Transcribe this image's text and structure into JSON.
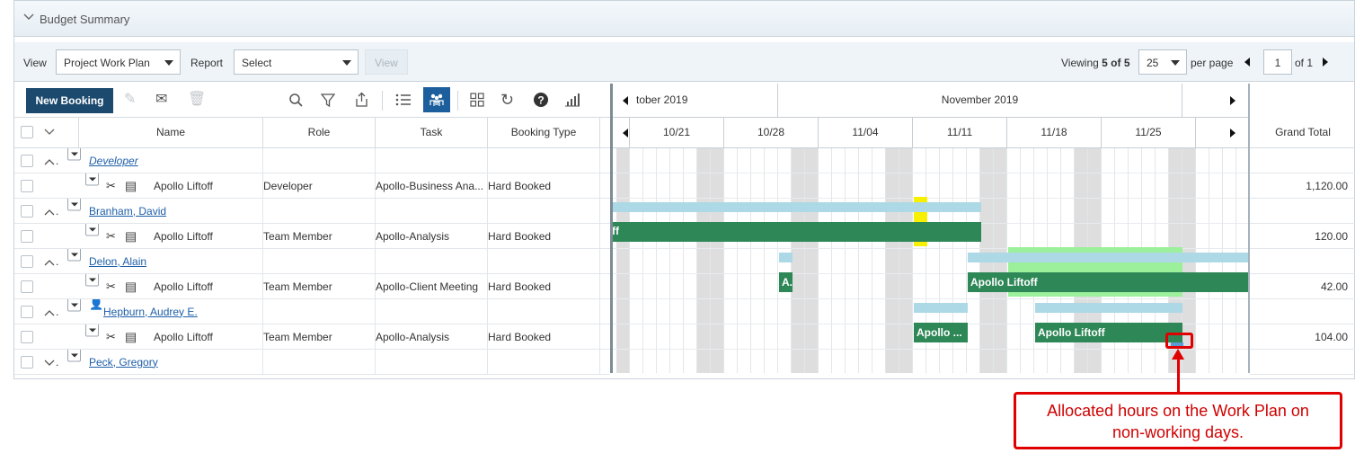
{
  "panel": {
    "title": "Budget Summary"
  },
  "toolbar": {
    "view_label": "View",
    "view_value": "Project Work Plan",
    "report_label": "Report",
    "report_value": "Select",
    "view_button": "View",
    "viewing_prefix": "Viewing",
    "viewing_range": "5 of 5",
    "page_size": "25",
    "per_page_label": "per page",
    "page_number": "1",
    "of_pages": "of 1"
  },
  "actions": {
    "new_booking": "New Booking",
    "icons": [
      "edit-icon",
      "email-icon",
      "delete-icon",
      "search-icon",
      "filter-icon",
      "export-icon",
      "list-icon",
      "people-view-icon",
      "grid-icon",
      "refresh-icon",
      "help-icon",
      "chart-icon"
    ]
  },
  "columns": {
    "name": "Name",
    "role": "Role",
    "task": "Task",
    "booking_type": "Booking Type",
    "grand_total": "Grand Total"
  },
  "rows": [
    {
      "type": "group",
      "name": "Developer",
      "italic": true,
      "total": ""
    },
    {
      "type": "booking",
      "name": "Apollo Liftoff",
      "role": "Developer",
      "task": "Apollo-Business Ana...",
      "booking_type": "Hard Booked",
      "total": "1,120.00"
    },
    {
      "type": "group",
      "name": "Branham, David",
      "italic": false,
      "total": ""
    },
    {
      "type": "booking",
      "name": "Apollo Liftoff",
      "role": "Team Member",
      "task": "Apollo-Analysis",
      "booking_type": "Hard Booked",
      "total": "120.00"
    },
    {
      "type": "group",
      "name": "Delon, Alain",
      "italic": false,
      "total": ""
    },
    {
      "type": "booking",
      "name": "Apollo Liftoff",
      "role": "Team Member",
      "task": "Apollo-Client Meeting",
      "booking_type": "Hard Booked",
      "total": "42.00"
    },
    {
      "type": "group",
      "name": "Hepburn, Audrey E.",
      "italic": false,
      "warning": true,
      "total": ""
    },
    {
      "type": "booking",
      "name": "Apollo Liftoff",
      "role": "Team Member",
      "task": "Apollo-Analysis",
      "booking_type": "Hard Booked",
      "total": "104.00"
    },
    {
      "type": "group",
      "name": "Peck, Gregory",
      "italic": false,
      "collapsed": true,
      "total": ""
    }
  ],
  "timeline": {
    "months": [
      "tober 2019",
      "November 2019"
    ],
    "weeks": [
      "10/21",
      "10/28",
      "11/04",
      "11/11",
      "11/18",
      "11/25"
    ]
  },
  "bars": {
    "branham_label": "ff",
    "delon_label_short": "A.",
    "delon_label": "Apollo Liftoff",
    "hepburn_label_short": "Apollo ...",
    "hepburn_label": "Apollo Liftoff"
  },
  "colors": {
    "brand": "#1c4a6e",
    "booking_bar": "#2e8757",
    "allocation_bar": "#add8e6",
    "highlight_green": "#9cf09c",
    "today_marker": "#f7f000",
    "callout": "#e00000"
  },
  "callout": {
    "line1": "Allocated hours on the Work Plan on",
    "line2": "non-working days."
  }
}
